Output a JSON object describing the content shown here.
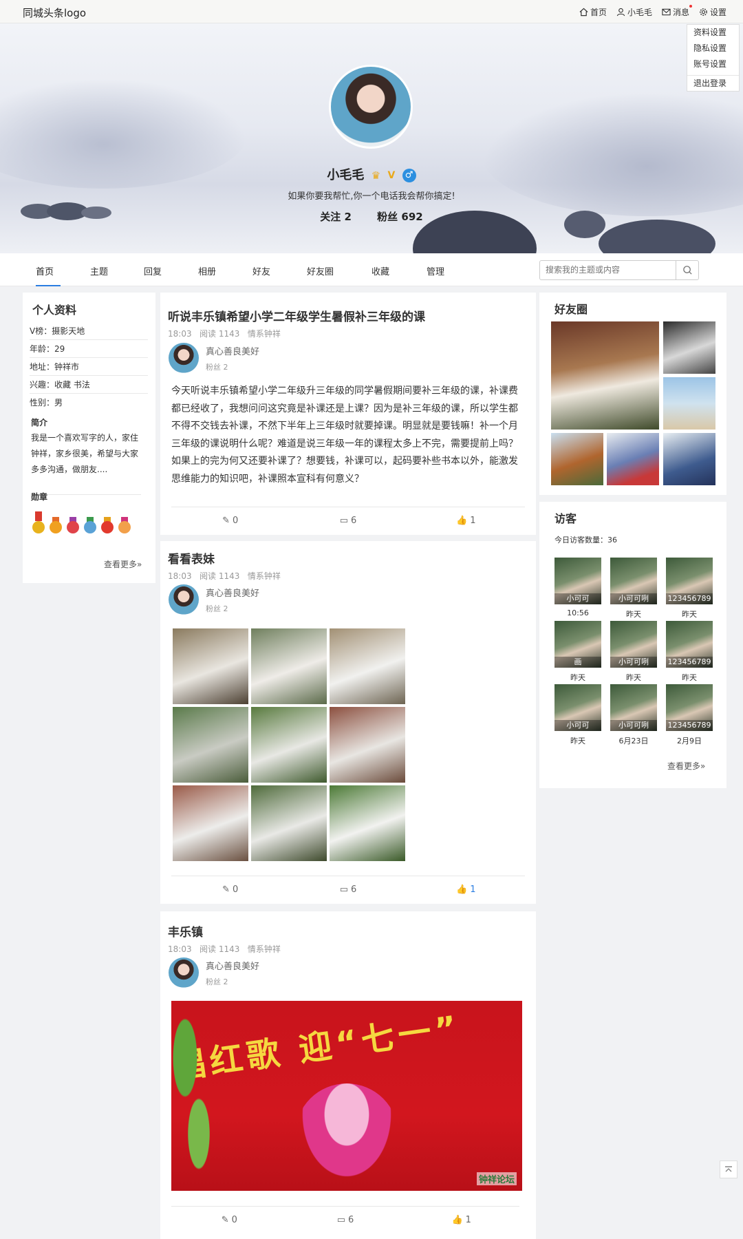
{
  "topbar": {
    "logo": "同城头条logo",
    "nav": [
      {
        "label": "首页",
        "icon": "home-icon"
      },
      {
        "label": "小毛毛",
        "icon": "user-icon"
      },
      {
        "label": "消息",
        "icon": "mail-icon"
      },
      {
        "label": "设置",
        "icon": "gear-icon"
      }
    ]
  },
  "settings_menu": [
    "资料设置",
    "隐私设置",
    "账号设置",
    "退出登录"
  ],
  "profile": {
    "name": "小毛毛",
    "bio": "如果你要我帮忙,你一个电话我会帮你搞定!",
    "follow": "关注 2",
    "fans": "粉丝 692"
  },
  "tabs": [
    "首页",
    "主题",
    "回复",
    "相册",
    "好友",
    "好友圈",
    "收藏",
    "管理"
  ],
  "search": {
    "placeholder": "搜索我的主题或内容"
  },
  "sidebar": {
    "title": "个人资料",
    "rows": [
      "V榜：摄影天地",
      "年龄：29",
      "地址：钟祥市",
      "兴趣：收藏  书法",
      "性别：男"
    ],
    "intro_title": "简介",
    "intro": "我是一个喜欢写字的人，家住钟祥，家乡很美，希望与大家多多沟通，做朋友....",
    "medals_title": "勋章",
    "more": "查看更多"
  },
  "posts": [
    {
      "title": "听说丰乐镇希望小学二年级学生暑假补三年级的课",
      "time": "18:03",
      "reads": "阅读 1143",
      "tag": "情系钟祥",
      "author": "真心善良美好",
      "fans": "粉丝 2",
      "text": "今天听说丰乐镇希望小学二年级升三年级的同学暑假期间要补三年级的课，补课费都已经收了，我想问问这究竟是补课还是上课？因为是补三年级的课，所以学生都不得不交钱去补课，不然下半年上三年级时就要掉课。明显就是要钱嘛！补一个月三年级的课说明什么呢？难道是说三年级一年的课程太多上不完，需要提前上吗？如果上的完为何又还要补课了？想要钱，补课可以，起码要补些书本以外，能激发思维能力的知识吧，补课照本宣科有何意义？",
      "edit": "0",
      "comments": "6",
      "likes": "1"
    },
    {
      "title": "看看表妹",
      "time": "18:03",
      "reads": "阅读 1143",
      "tag": "情系钟祥",
      "author": "真心善良美好",
      "fans": "粉丝 2",
      "edit": "0",
      "comments": "6",
      "likes": "1"
    },
    {
      "title": "丰乐镇",
      "time": "18:03",
      "reads": "阅读 1143",
      "tag": "情系钟祥",
      "author": "真心善良美好",
      "fans": "粉丝 2",
      "edit": "0",
      "comments": "6",
      "likes": "1",
      "photo_caption": "唱红歌 迎“七一”",
      "watermark": "钟祥论坛"
    }
  ],
  "friends_circle": {
    "title": "好友圈"
  },
  "visitors": {
    "title": "访客",
    "count": "今日访客数量：36",
    "list": [
      {
        "name": "小可可",
        "time": "10:56"
      },
      {
        "name": "小可可咧",
        "time": "昨天"
      },
      {
        "name": "123456789",
        "time": "昨天"
      },
      {
        "name": "画",
        "time": "昨天"
      },
      {
        "name": "小可可咧",
        "time": "昨天"
      },
      {
        "name": "123456789",
        "time": "昨天"
      },
      {
        "name": "小可可",
        "time": "昨天"
      },
      {
        "name": "小可可咧",
        "time": "6月23日"
      },
      {
        "name": "123456789",
        "time": "2月9日"
      }
    ],
    "more": "查看更多"
  }
}
